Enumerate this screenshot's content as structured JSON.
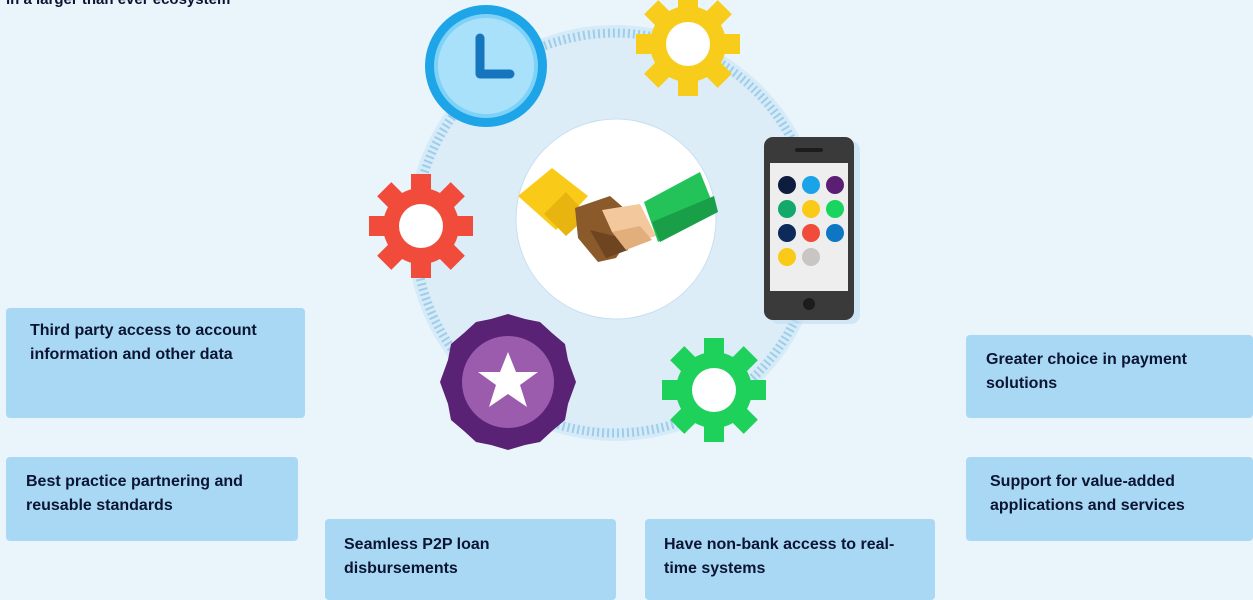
{
  "heading": "in a larger than ever ecosystem",
  "cards": {
    "third_party": "Third party access to account information and other data",
    "best_practice": "Best practice partnering and reusable standards",
    "p2p": "Seamless P2P loan disbursements",
    "non_bank": "Have non-bank access to real-time systems",
    "greater_choice": "Greater choice in payment solutions",
    "value_added": "Support for value-added applications and services"
  },
  "icons": {
    "center": "handshake-icon",
    "top_left": "clock-icon",
    "top_right": "gear-icon",
    "left": "gear-icon",
    "bottom_left": "star-badge-icon",
    "bottom_right": "gear-icon",
    "right": "smartphone-icon"
  },
  "colors": {
    "background": "#eaf4fb",
    "card": "#a8d8f3",
    "text": "#0b1533",
    "ring": "#a9d3ee",
    "clock": "#1ea5e8",
    "gear_yellow": "#f8cc1b",
    "gear_red": "#f14b3b",
    "gear_green": "#1ed15a",
    "badge_purple": "#5a2274",
    "phone": "#3a3a3a"
  },
  "phone_app_dots": [
    "#0e1d3f",
    "#1aa3e8",
    "#5a1f73",
    "#14a86b",
    "#f9cb18",
    "#19d45e",
    "#0e2a5a",
    "#f14b3b",
    "#0d77c3",
    "#f9cb18",
    "#c9c5c2"
  ]
}
